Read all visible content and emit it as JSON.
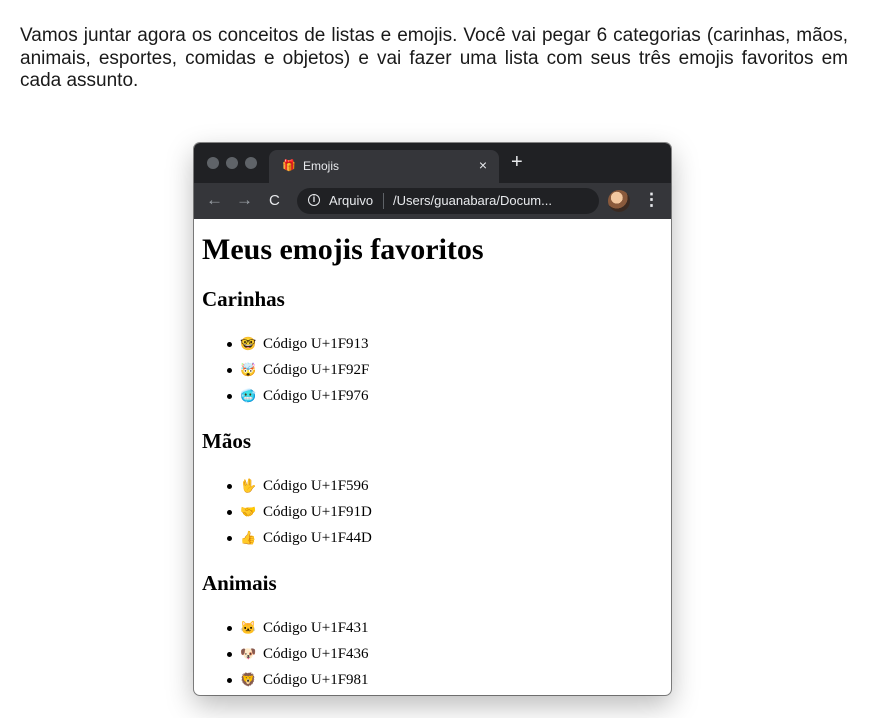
{
  "intro": "Vamos juntar agora os conceitos de listas e emojis. Você vai pegar 6 categorias (carinhas, mãos, animais, esportes, comidas e objetos) e vai fazer uma lista com seus três emojis favoritos em cada assunto.",
  "browser": {
    "tab_title": "Emojis",
    "tab_close": "×",
    "new_tab": "+",
    "back_icon": "←",
    "forward_icon": "→",
    "reload_icon": "C",
    "info_icon": "i",
    "address_scheme": "Arquivo",
    "address_url": "/Users/guanabara/Docum...",
    "star_icon": "☆",
    "menu_icon": "⋮",
    "favicon": "🎁",
    "colors": {
      "titlebar": "#202124",
      "tab": "#35363a",
      "window_dot": "#5f6368"
    }
  },
  "page": {
    "title": "Meus emojis favoritos",
    "sections": [
      {
        "heading": "Carinhas",
        "items": [
          {
            "emoji": "🤓",
            "text": "Código U+1F913"
          },
          {
            "emoji": "🤯",
            "text": "Código U+1F92F"
          },
          {
            "emoji": "🥶",
            "text": "Código U+1F976"
          }
        ]
      },
      {
        "heading": "Mãos",
        "items": [
          {
            "emoji": "🖖",
            "text": "Código U+1F596"
          },
          {
            "emoji": "🤝",
            "text": "Código U+1F91D"
          },
          {
            "emoji": "👍",
            "text": "Código U+1F44D"
          }
        ]
      },
      {
        "heading": "Animais",
        "items": [
          {
            "emoji": "🐱",
            "text": "Código U+1F431"
          },
          {
            "emoji": "🐶",
            "text": "Código U+1F436"
          },
          {
            "emoji": "🦁",
            "text": "Código U+1F981"
          }
        ]
      }
    ]
  }
}
